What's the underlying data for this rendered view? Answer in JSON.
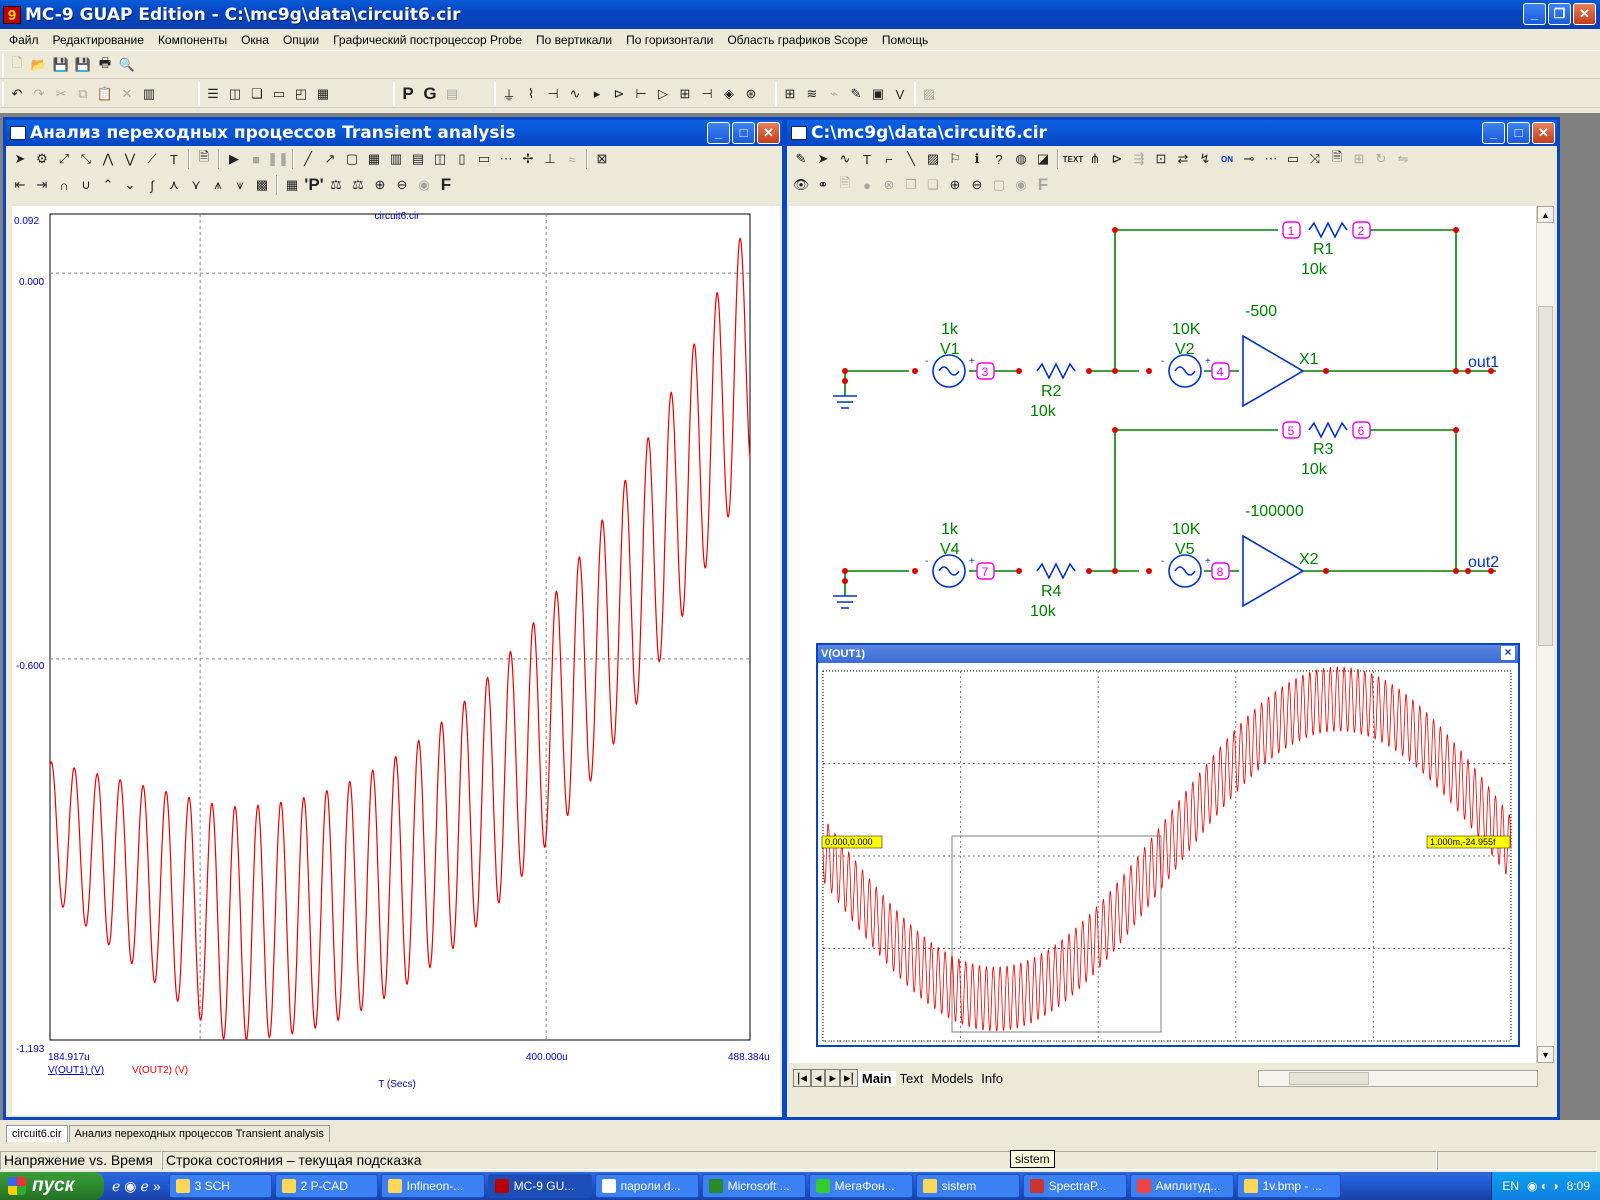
{
  "app": {
    "title": "MC-9 GUAP Edition - C:\\mc9g\\data\\circuit6.cir",
    "icon_glyph": "9"
  },
  "menu": [
    "Файл",
    "Редактирование",
    "Компоненты",
    "Окна",
    "Опции",
    "Графический построцессор Probe",
    "По вертикали",
    "По горизонтали",
    "Область графиков Scope",
    "Помощь"
  ],
  "toolbar_main": {
    "probe_letters": [
      "P",
      "G"
    ]
  },
  "analysis_window": {
    "title": "Анализ переходных процессов Transient analysis",
    "plot": {
      "file_label": "circuit6.cir",
      "y_ticks": [
        "0.092",
        "0.000",
        "-0.600",
        "-1.193"
      ],
      "x_ticks": [
        "184.917u",
        "400.000u",
        "488.384u"
      ],
      "x_axis_label": "T (Secs)",
      "legend": [
        {
          "name": "V(OUT1) (V)",
          "color": "#0000cc"
        },
        {
          "name": "V(OUT2) (V)",
          "color": "#ee0000"
        }
      ]
    },
    "toolbar_letters": [
      "'P'",
      "F"
    ]
  },
  "chart_data": {
    "type": "line",
    "xlabel": "T (Secs)",
    "ylabel": "",
    "xlim": [
      184.917,
      488.384
    ],
    "ylim": [
      -1.193,
      0.092
    ],
    "x_unit": "u",
    "series": [
      {
        "name": "V(OUT2) (V)",
        "color": "#ee0000",
        "description": "oscillation ~10 kHz riding on rising curve",
        "envelope": {
          "upper_start": -0.76,
          "upper_min": -0.83,
          "upper_end": 0.092,
          "lower_start": -0.97,
          "lower_min": -1.193,
          "lower_end": -0.3
        }
      },
      {
        "name": "V(OUT1) (V)",
        "color": "#0000cc",
        "description": "overlaps V(OUT2)"
      }
    ]
  },
  "schematic_window": {
    "title": "C:\\mc9g\\data\\circuit6.cir",
    "components": [
      {
        "ref": "R1",
        "value": "10k"
      },
      {
        "ref": "R2",
        "value": "10k"
      },
      {
        "ref": "V1",
        "value": "1k"
      },
      {
        "ref": "V2",
        "value": "10K"
      },
      {
        "ref": "X1",
        "value": "-500"
      },
      {
        "ref": "R3",
        "value": "10k"
      },
      {
        "ref": "R4",
        "value": "10k"
      },
      {
        "ref": "V4",
        "value": "1k"
      },
      {
        "ref": "V5",
        "value": "10K"
      },
      {
        "ref": "X2",
        "value": "-100000"
      }
    ],
    "nodes": [
      "1",
      "2",
      "3",
      "4",
      "5",
      "6",
      "7",
      "8"
    ],
    "outputs": [
      "out1",
      "out2"
    ],
    "toolbar_text_btn": "TEXT",
    "toolbar_on_btn": "ON",
    "toolbar_f_btn": "F",
    "tabs": [
      "Main",
      "Text",
      "Models",
      "Info"
    ]
  },
  "scope_window": {
    "title": "V(OUT1)",
    "close_glyph": "×",
    "cursor_left": "0.000,0.000",
    "cursor_right": "1.000m,-24.955f"
  },
  "doc_tabs": [
    "circuit6.cir",
    "Анализ переходных процессов Transient analysis"
  ],
  "status": {
    "left": "Напряжение vs. Время",
    "hint": "Строка состояния – текущая подсказка",
    "tooltip": "sistem"
  },
  "taskbar": {
    "start": "пуск",
    "tasks": [
      "3 SCH",
      "2 P-CAD",
      "Infineon-...",
      "MC-9 GU...",
      "пароли.d...",
      "Microsoft ...",
      "МегаФон...",
      "sistem",
      "SpectraP...",
      "Амплитуд...",
      "1v.bmp - ..."
    ],
    "active_task_index": 3,
    "lang": "EN",
    "clock": "8:09"
  },
  "colors": {
    "xp_blue": "#0846c8",
    "wire": "#008000",
    "component": "#0033cc",
    "node": "#ee00ee",
    "trace": "#ee0000",
    "axis_text": "#0000cc",
    "cursor_label_bg": "#ffff00"
  }
}
